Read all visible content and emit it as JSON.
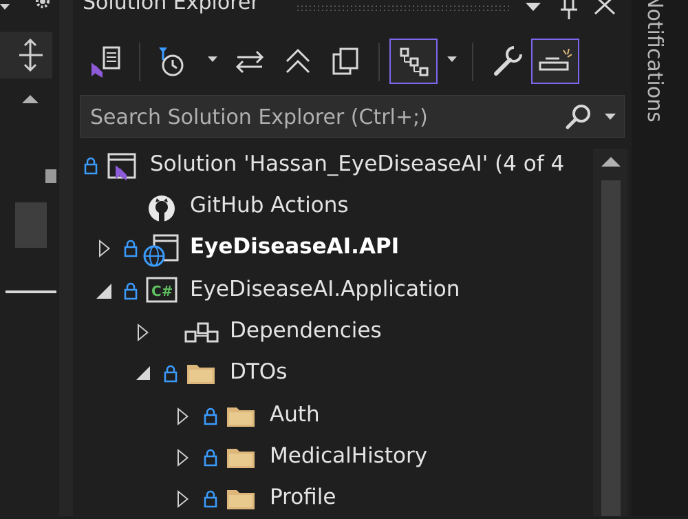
{
  "panel": {
    "title": "Solution Explorer",
    "pin_label": "Pin",
    "close_label": "Close"
  },
  "search": {
    "placeholder": "Search Solution Explorer (Ctrl+;)"
  },
  "tree": {
    "solution": "Solution 'Hassan_EyeDiseaseAI' (4 of 4",
    "github_actions": "GitHub Actions",
    "api_project": "EyeDiseaseAI.API",
    "app_project": "EyeDiseaseAI.Application",
    "dependencies": "Dependencies",
    "dtos": "DTOs",
    "auth": "Auth",
    "medical_history": "MedicalHistory",
    "profile": "Profile"
  },
  "right_strip": {
    "label": "Notifications"
  },
  "colors": {
    "accent": "#7b68ee",
    "lock": "#3b9cff",
    "folder": "#dcb67a",
    "csharp": "#5fbf5f",
    "vs_purple": "#8e5bd8"
  }
}
